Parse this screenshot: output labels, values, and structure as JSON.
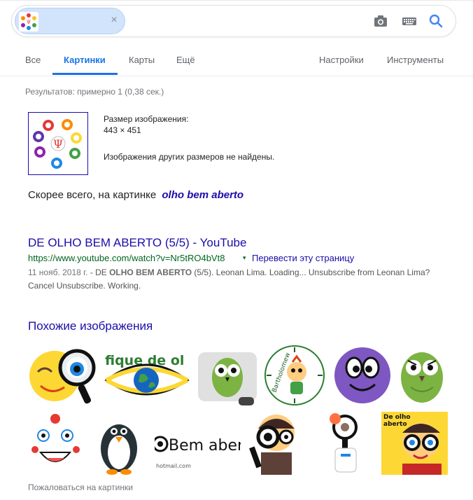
{
  "search": {
    "close_glyph": "×"
  },
  "tabs": [
    {
      "label": "Все"
    },
    {
      "label": "Картинки"
    },
    {
      "label": "Карты"
    },
    {
      "label": "Ещё"
    },
    {
      "label": "Настройки"
    },
    {
      "label": "Инструменты"
    }
  ],
  "results_stats": "Результатов: примерно 1 (0,38 сек.)",
  "image_info": {
    "size_label": "Размер изображения:",
    "size_value": "443 × 451",
    "no_other_sizes": "Изображения других размеров не найдены."
  },
  "best_guess": {
    "prefix": "Скорее всего, на картинке",
    "query": "olho bem aberto"
  },
  "result": {
    "title": "DE OLHO BEM ABERTO (5/5) - YouTube",
    "url": "https://www.youtube.com/watch?v=Nr5tRO4bVt8",
    "translate_caret": "▾",
    "translate_link": "Перевести эту страницу",
    "date": "11 нояб. 2018 г.",
    "snippet_dash": " - DE ",
    "snippet_bold": "OLHO BEM ABERTO",
    "snippet_rest": " (5/5). Leonan Lima. Loading... Unsubscribe from Leonan Lima? Cancel Unsubscribe. Working."
  },
  "similar": {
    "title": "Похожие изображения",
    "thumbs": {
      "fique_text": "fique de ol",
      "bartholomew_text": "Bartholomew",
      "bem_aberto_text": "Bem aber",
      "hotmail_text": "hotmail.com",
      "de_olho_text_1": "De olho",
      "de_olho_text_2": "aberto"
    }
  },
  "report_link": "Пожаловаться на картинки",
  "colors": {
    "accent_blue": "#1a73e8",
    "link_blue": "#1a0dab",
    "url_green": "#006621"
  }
}
